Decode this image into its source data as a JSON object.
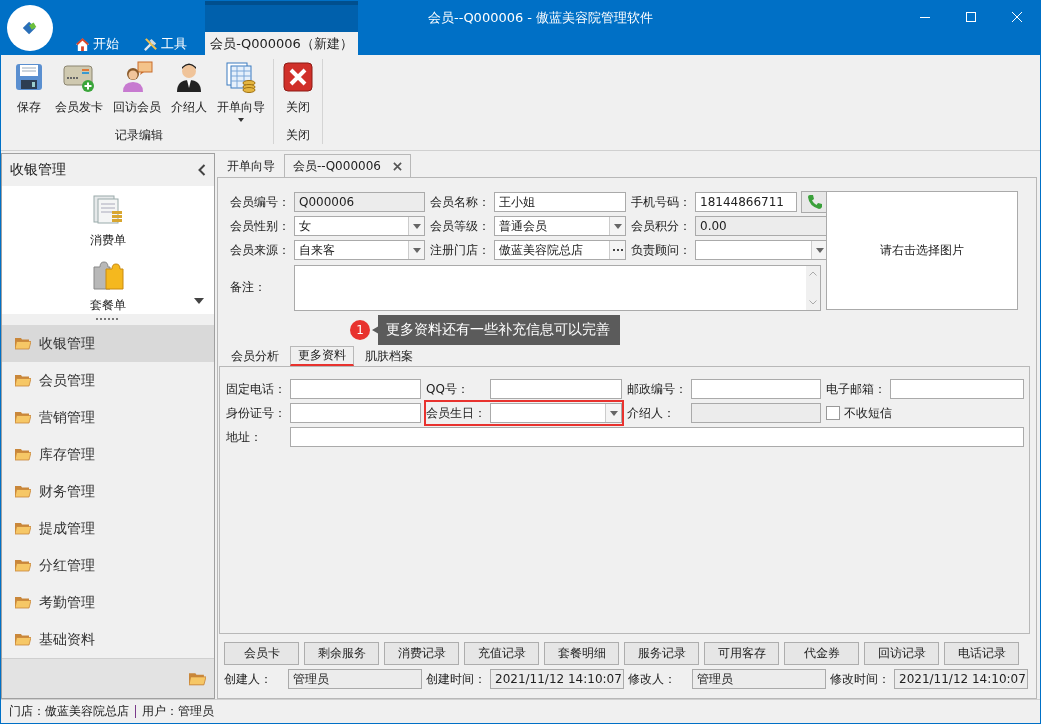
{
  "window": {
    "title": "会员--Q000006 - 傲蓝美容院管理软件"
  },
  "ribbon_tabs": [
    {
      "label": "开始",
      "selected": false
    },
    {
      "label": "工具",
      "selected": false
    },
    {
      "label": "会员-Q000006（新建）",
      "selected": true
    }
  ],
  "ribbon_groups": [
    {
      "label": "记录编辑",
      "buttons": [
        {
          "label": "保存"
        },
        {
          "label": "会员发卡"
        },
        {
          "label": "回访会员"
        },
        {
          "label": "介绍人"
        },
        {
          "label": "开单向导",
          "dropdown": true
        }
      ]
    },
    {
      "label": "关闭",
      "buttons": [
        {
          "label": "关闭"
        }
      ]
    }
  ],
  "sidebar": {
    "title": "收银管理",
    "shortcuts": [
      {
        "label": "消费单"
      },
      {
        "label": "套餐单"
      }
    ],
    "items": [
      {
        "label": "收银管理",
        "selected": true
      },
      {
        "label": "会员管理",
        "selected": false
      },
      {
        "label": "营销管理",
        "selected": false
      },
      {
        "label": "库存管理",
        "selected": false
      },
      {
        "label": "财务管理",
        "selected": false
      },
      {
        "label": "提成管理",
        "selected": false
      },
      {
        "label": "分红管理",
        "selected": false
      },
      {
        "label": "考勤管理",
        "selected": false
      },
      {
        "label": "基础资料",
        "selected": false
      }
    ]
  },
  "document_tabs": [
    {
      "label": "开单向导",
      "selected": false,
      "closable": false
    },
    {
      "label": "会员--Q000006",
      "selected": true,
      "closable": true
    }
  ],
  "member_form": {
    "rows": [
      [
        {
          "label": "会员编号：",
          "value": "Q000006",
          "kind": "readonly"
        },
        {
          "label": "会员名称：",
          "value": "王小姐",
          "kind": "text"
        },
        {
          "label": "手机号码：",
          "value": "18144866711",
          "kind": "phone"
        }
      ],
      [
        {
          "label": "会员性别：",
          "value": "女",
          "kind": "combo"
        },
        {
          "label": "会员等级：",
          "value": "普通会员",
          "kind": "combo"
        },
        {
          "label": "会员积分：",
          "value": "0.00",
          "kind": "readonly"
        }
      ],
      [
        {
          "label": "会员来源：",
          "value": "自来客",
          "kind": "combo"
        },
        {
          "label": "注册门店：",
          "value": "傲蓝美容院总店",
          "kind": "lookup"
        },
        {
          "label": "负责顾问：",
          "kind": "combo"
        }
      ]
    ],
    "remark_label": "备注：",
    "photo_hint": "请右击选择图片"
  },
  "tooltip": {
    "badge": "1",
    "text": "更多资料还有一些补充信息可以完善"
  },
  "sub_tabs": [
    {
      "label": "会员分析",
      "selected": false
    },
    {
      "label": "更多资料",
      "selected": true
    },
    {
      "label": "肌肤档案",
      "selected": false
    }
  ],
  "more_info": {
    "rows": [
      [
        {
          "label": "固定电话：",
          "kind": "text"
        },
        {
          "label": "QQ号：",
          "kind": "text"
        },
        {
          "label": "邮政编号：",
          "kind": "text"
        },
        {
          "label": "电子邮箱：",
          "kind": "text"
        }
      ],
      [
        {
          "label": "身份证号：",
          "kind": "text"
        },
        {
          "label": "会员生日：",
          "kind": "combo",
          "highlighted": true
        },
        {
          "label": "介绍人：",
          "kind": "readonly"
        },
        {
          "label": "不收短信",
          "kind": "checkbox",
          "checked": false
        }
      ]
    ],
    "address_label": "地址："
  },
  "record_buttons": [
    "会员卡",
    "剩余服务",
    "消费记录",
    "充值记录",
    "套餐明细",
    "服务记录",
    "可用客存",
    "代金券",
    "回访记录",
    "电话记录"
  ],
  "audit": [
    {
      "label": "创建人：",
      "value": "管理员"
    },
    {
      "label": "创建时间：",
      "value": "2021/11/12 14:10:07"
    },
    {
      "label": "修改人：",
      "value": "管理员"
    },
    {
      "label": "修改时间：",
      "value": "2021/11/12 14:10:07"
    }
  ],
  "status_bar": {
    "store": "门店：傲蓝美容院总店",
    "user": "用户：管理员"
  }
}
